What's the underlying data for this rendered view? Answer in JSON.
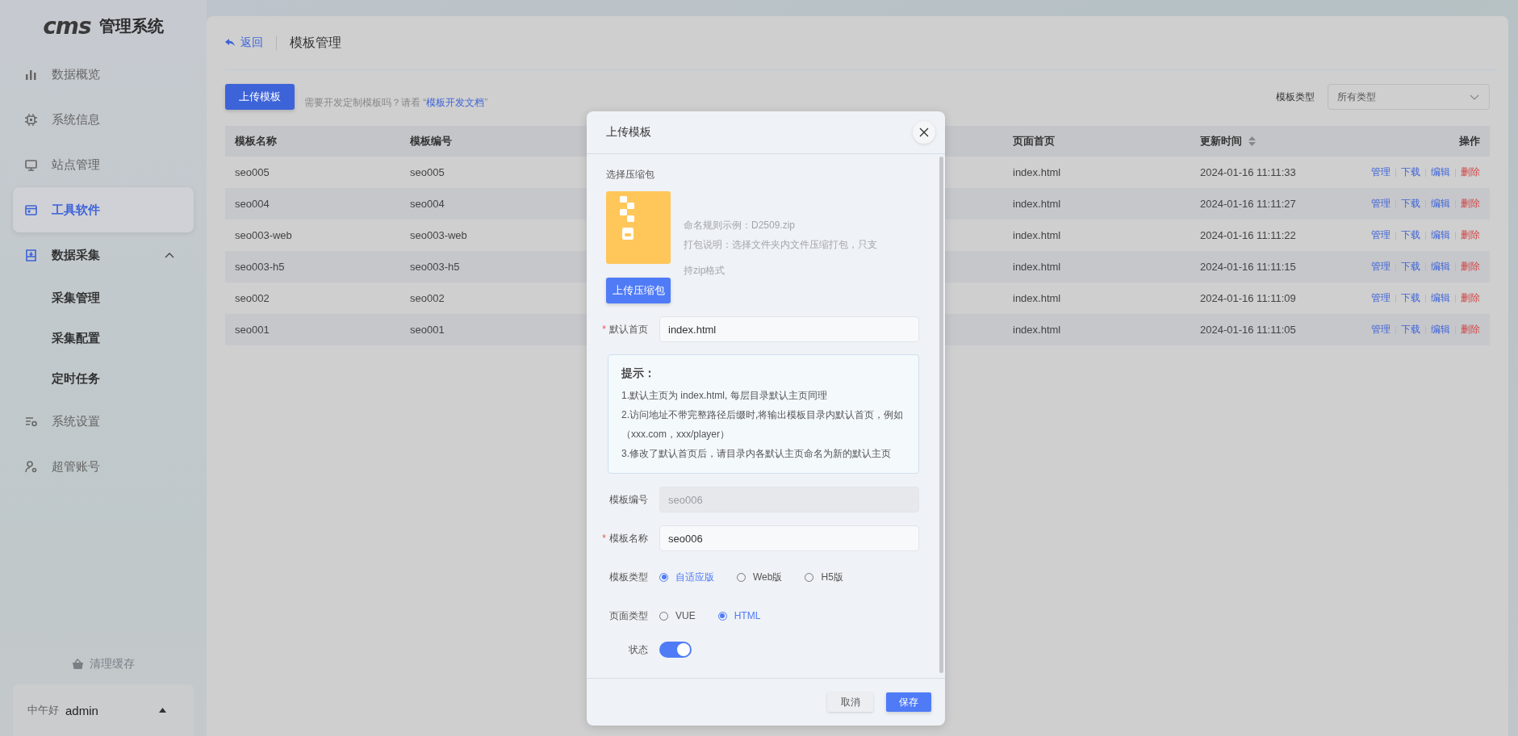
{
  "sidebar": {
    "logo": "cms",
    "title": "管理系统",
    "items": [
      {
        "label": "数据概览",
        "selected": false
      },
      {
        "label": "系统信息",
        "selected": false
      },
      {
        "label": "站点管理",
        "selected": false
      },
      {
        "label": "工具软件",
        "selected": true
      },
      {
        "label": "数据采集",
        "selected": false,
        "expanded": true,
        "children": [
          {
            "label": "采集管理",
            "selected": false
          },
          {
            "label": "采集配置",
            "selected": false
          },
          {
            "label": "定时任务",
            "selected": false
          }
        ]
      },
      {
        "label": "系统设置",
        "selected": false
      },
      {
        "label": "超管账号",
        "selected": false
      }
    ],
    "clear_cache": "清理缓存",
    "greeting": "中午好",
    "user": "admin"
  },
  "page": {
    "back": "返回",
    "title": "模板管理",
    "upload_button": "上传模板",
    "hint": "需要开发定制模板吗？请看 “",
    "doc_link": "模板开发文档",
    "hint_end": "”",
    "filter": {
      "label": "模板类型",
      "value": "所有类型"
    }
  },
  "table": {
    "columns": [
      {
        "label": "模板名称"
      },
      {
        "label": "模板编号"
      },
      {
        "label": "页面首页"
      },
      {
        "label": "更新时间",
        "sortable": true
      },
      {
        "label": "操作"
      }
    ],
    "rows": [
      {
        "name": "seo005",
        "code": "seo005",
        "home": "index.html",
        "updated": "2024-01-16 11:11:33",
        "actions": [
          {
            "label": "管理",
            "kind": "link"
          },
          {
            "label": "下载",
            "kind": "link"
          },
          {
            "label": "编辑",
            "kind": "link"
          },
          {
            "label": "删除",
            "kind": "danger"
          }
        ]
      },
      {
        "name": "seo004",
        "code": "seo004",
        "home": "index.html",
        "updated": "2024-01-16 11:11:27",
        "actions": [
          {
            "label": "管理",
            "kind": "link"
          },
          {
            "label": "下载",
            "kind": "link"
          },
          {
            "label": "编辑",
            "kind": "link"
          },
          {
            "label": "删除",
            "kind": "danger"
          }
        ]
      },
      {
        "name": "seo003-web",
        "code": "seo003-web",
        "home": "index.html",
        "updated": "2024-01-16 11:11:22",
        "actions": [
          {
            "label": "管理",
            "kind": "link"
          },
          {
            "label": "下载",
            "kind": "link"
          },
          {
            "label": "编辑",
            "kind": "link"
          },
          {
            "label": "删除",
            "kind": "danger"
          }
        ]
      },
      {
        "name": "seo003-h5",
        "code": "seo003-h5",
        "home": "index.html",
        "updated": "2024-01-16 11:11:15",
        "actions": [
          {
            "label": "管理",
            "kind": "link"
          },
          {
            "label": "下载",
            "kind": "link"
          },
          {
            "label": "编辑",
            "kind": "link"
          },
          {
            "label": "删除",
            "kind": "danger"
          }
        ]
      },
      {
        "name": "seo002",
        "code": "seo002",
        "home": "index.html",
        "updated": "2024-01-16 11:11:09",
        "actions": [
          {
            "label": "管理",
            "kind": "link"
          },
          {
            "label": "下载",
            "kind": "link"
          },
          {
            "label": "编辑",
            "kind": "link"
          },
          {
            "label": "删除",
            "kind": "danger"
          }
        ]
      },
      {
        "name": "seo001",
        "code": "seo001",
        "home": "index.html",
        "updated": "2024-01-16 11:11:05",
        "actions": [
          {
            "label": "管理",
            "kind": "link"
          },
          {
            "label": "下载",
            "kind": "link"
          },
          {
            "label": "编辑",
            "kind": "link"
          },
          {
            "label": "删除",
            "kind": "danger"
          }
        ]
      }
    ]
  },
  "modal": {
    "title": "上传模板",
    "package_label": "选择压缩包",
    "naming_rule": "命名规则示例：D2509.zip",
    "pack_note": "打包说明：选择文件夹内文件压缩打包，只支持zip格式",
    "upload_button": "上传压缩包",
    "fields": [
      {
        "kind": "input",
        "mark": "*",
        "label": "默认首页",
        "disabled": false,
        "value": "index.html"
      },
      {
        "kind": "tip",
        "title": "提示：",
        "lines": [
          "1.默认主页为 index.html, 每层目录默认主页同理",
          "2.访问地址不带完整路径后缀时,将输出模板目录内默认首页，例如（xxx.com，xxx/player）",
          "3.修改了默认首页后，请目录内各默认主页命名为新的默认主页"
        ]
      },
      {
        "kind": "input",
        "label": "模板编号",
        "disabled": true,
        "value": "seo006"
      },
      {
        "kind": "input",
        "mark": "*",
        "label": "模板名称",
        "disabled": false,
        "value": "seo006"
      },
      {
        "kind": "radio",
        "label": "模板类型",
        "options": [
          {
            "label": "自适应版",
            "selected": true
          },
          {
            "label": "Web版",
            "selected": false
          },
          {
            "label": "H5版",
            "selected": false
          }
        ]
      },
      {
        "kind": "radio",
        "label": "页面类型",
        "options": [
          {
            "label": "VUE",
            "selected": false
          },
          {
            "label": "HTML",
            "selected": true
          }
        ]
      },
      {
        "kind": "switch",
        "label": "状态",
        "on": true
      }
    ],
    "cancel": "取消",
    "save": "保存"
  }
}
